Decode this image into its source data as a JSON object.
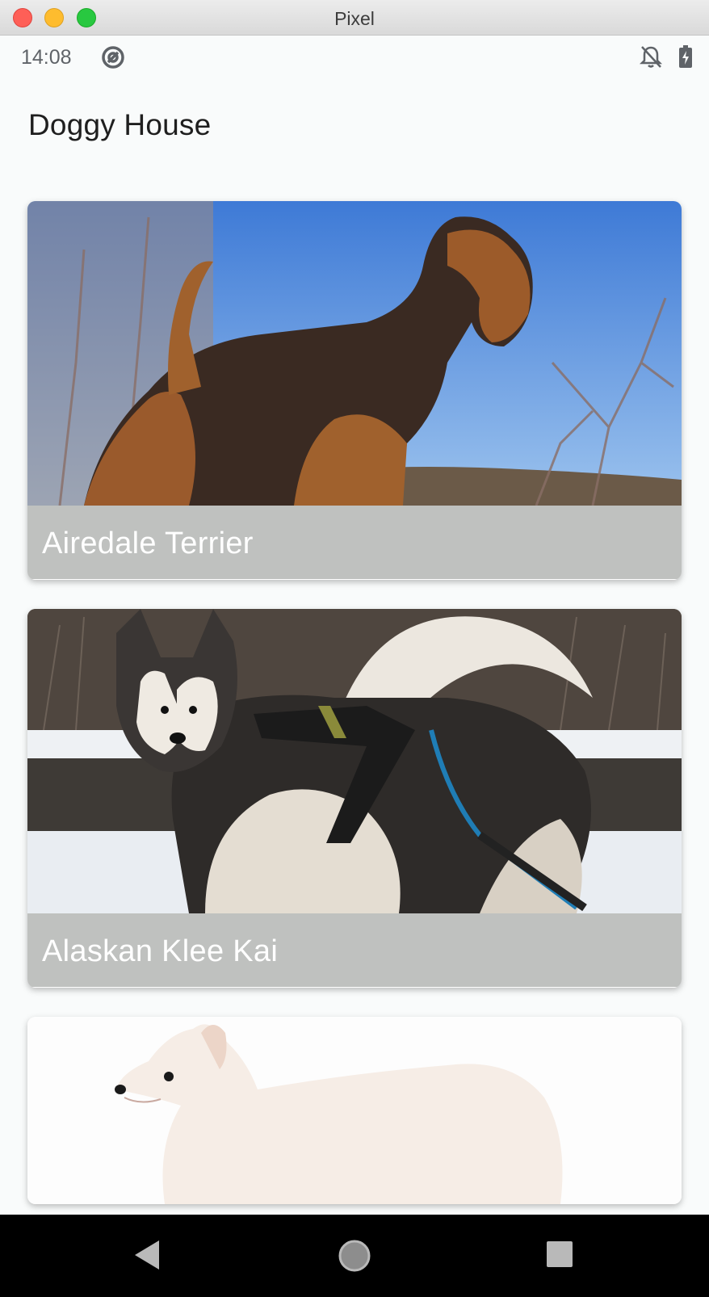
{
  "window": {
    "title": "Pixel"
  },
  "status_bar": {
    "time": "14:08"
  },
  "app": {
    "title": "Doggy House"
  },
  "cards": [
    {
      "caption": "Airedale Terrier"
    },
    {
      "caption": "Alaskan Klee Kai"
    },
    {
      "caption": ""
    }
  ],
  "colors": {
    "caption_bg": "#bfc1bf",
    "background": "#f9fbfb",
    "navbar": "#000000"
  },
  "icons": {
    "status": [
      "sync-icon",
      "notifications-off-icon",
      "battery-charging-icon"
    ],
    "nav": [
      "back-icon",
      "home-icon",
      "recents-icon"
    ]
  }
}
